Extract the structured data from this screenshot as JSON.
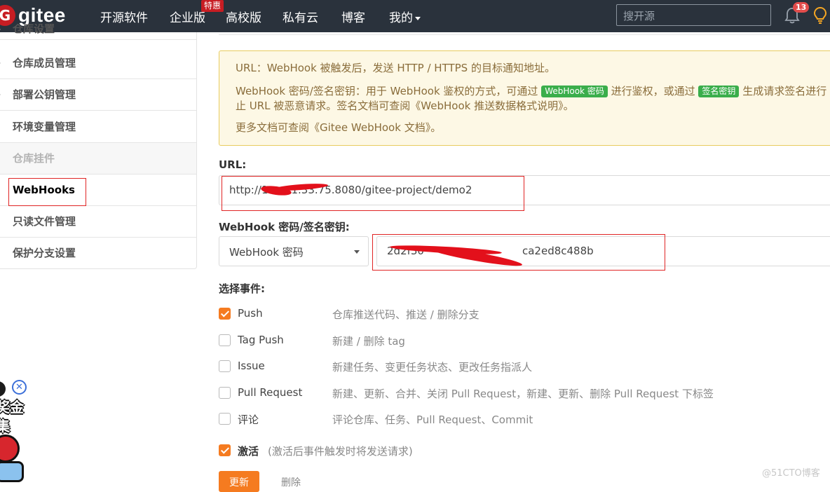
{
  "nav": {
    "logo_text": "gitee",
    "items": [
      "开源软件",
      "企业版",
      "高校版",
      "私有云",
      "博客",
      "我的"
    ],
    "special_badge": "特惠",
    "search_placeholder": "搜开源",
    "notification_count": "13"
  },
  "sidebar": {
    "top_cut_label": "仓库设置",
    "items": [
      {
        "label": "仓库成员管理",
        "state": "collapsible"
      },
      {
        "label": "部署公钥管理",
        "state": "collapsible"
      },
      {
        "label": "环境变量管理",
        "state": "normal"
      },
      {
        "label": "仓库挂件",
        "state": "disabled"
      },
      {
        "label": "WebHooks",
        "state": "active"
      },
      {
        "label": "只读文件管理",
        "state": "normal"
      },
      {
        "label": "保护分支设置",
        "state": "normal"
      }
    ]
  },
  "notice": {
    "line1": "URL：WebHook 被触发后，发送 HTTP / HTTPS 的目标通知地址。",
    "line2_a": "WebHook 密码/签名密钥：用于 WebHook 鉴权的方式，可通过",
    "pill_password": "WebHook 密码",
    "line2_b": "进行鉴权，或通过",
    "pill_signature": "签名密钥",
    "line2_c": "生成请求签名进行",
    "line3": "止 URL 被恶意请求。签名文档可查阅《WebHook 推送数据格式说明》。",
    "line4": "更多文档可查阅《Gitee WebHook 文档》。"
  },
  "form": {
    "url_label": "URL:",
    "url_prefix": "http://1",
    "url_suffix": "1.33.75.8080/gitee-project/demo2",
    "secret_label": "WebHook 密码/签名密钥:",
    "secret_type": "WebHook 密码",
    "secret_prefix": "2d2f30",
    "secret_suffix": "ca2ed8c488b",
    "events_label": "选择事件:",
    "events": [
      {
        "name": "Push",
        "desc": "仓库推送代码、推送 / 删除分支",
        "checked": true
      },
      {
        "name": "Tag Push",
        "desc": "新建 / 删除 tag",
        "checked": false
      },
      {
        "name": "Issue",
        "desc": "新建任务、变更任务状态、更改任务指派人",
        "checked": false
      },
      {
        "name": "Pull Request",
        "desc": "新建、更新、合并、关闭 Pull Request，新建、更新、删除 Pull Request 下标签",
        "checked": false
      },
      {
        "name": "评论",
        "desc": "评论仓库、任务、Pull Request、Commit",
        "checked": false
      }
    ],
    "activate_label": "激活",
    "activate_hint": "(激活后事件触发时将发送请求)",
    "activate_checked": true,
    "update_button": "更新",
    "delete_button": "删除"
  },
  "ad": {
    "line1": "奖金",
    "line2": "集"
  },
  "watermark": "@51CTO博客",
  "colors": {
    "navbar": "#2a323c",
    "accent": "#f57b20",
    "brand": "#c71d23",
    "annotation": "#e02424"
  }
}
